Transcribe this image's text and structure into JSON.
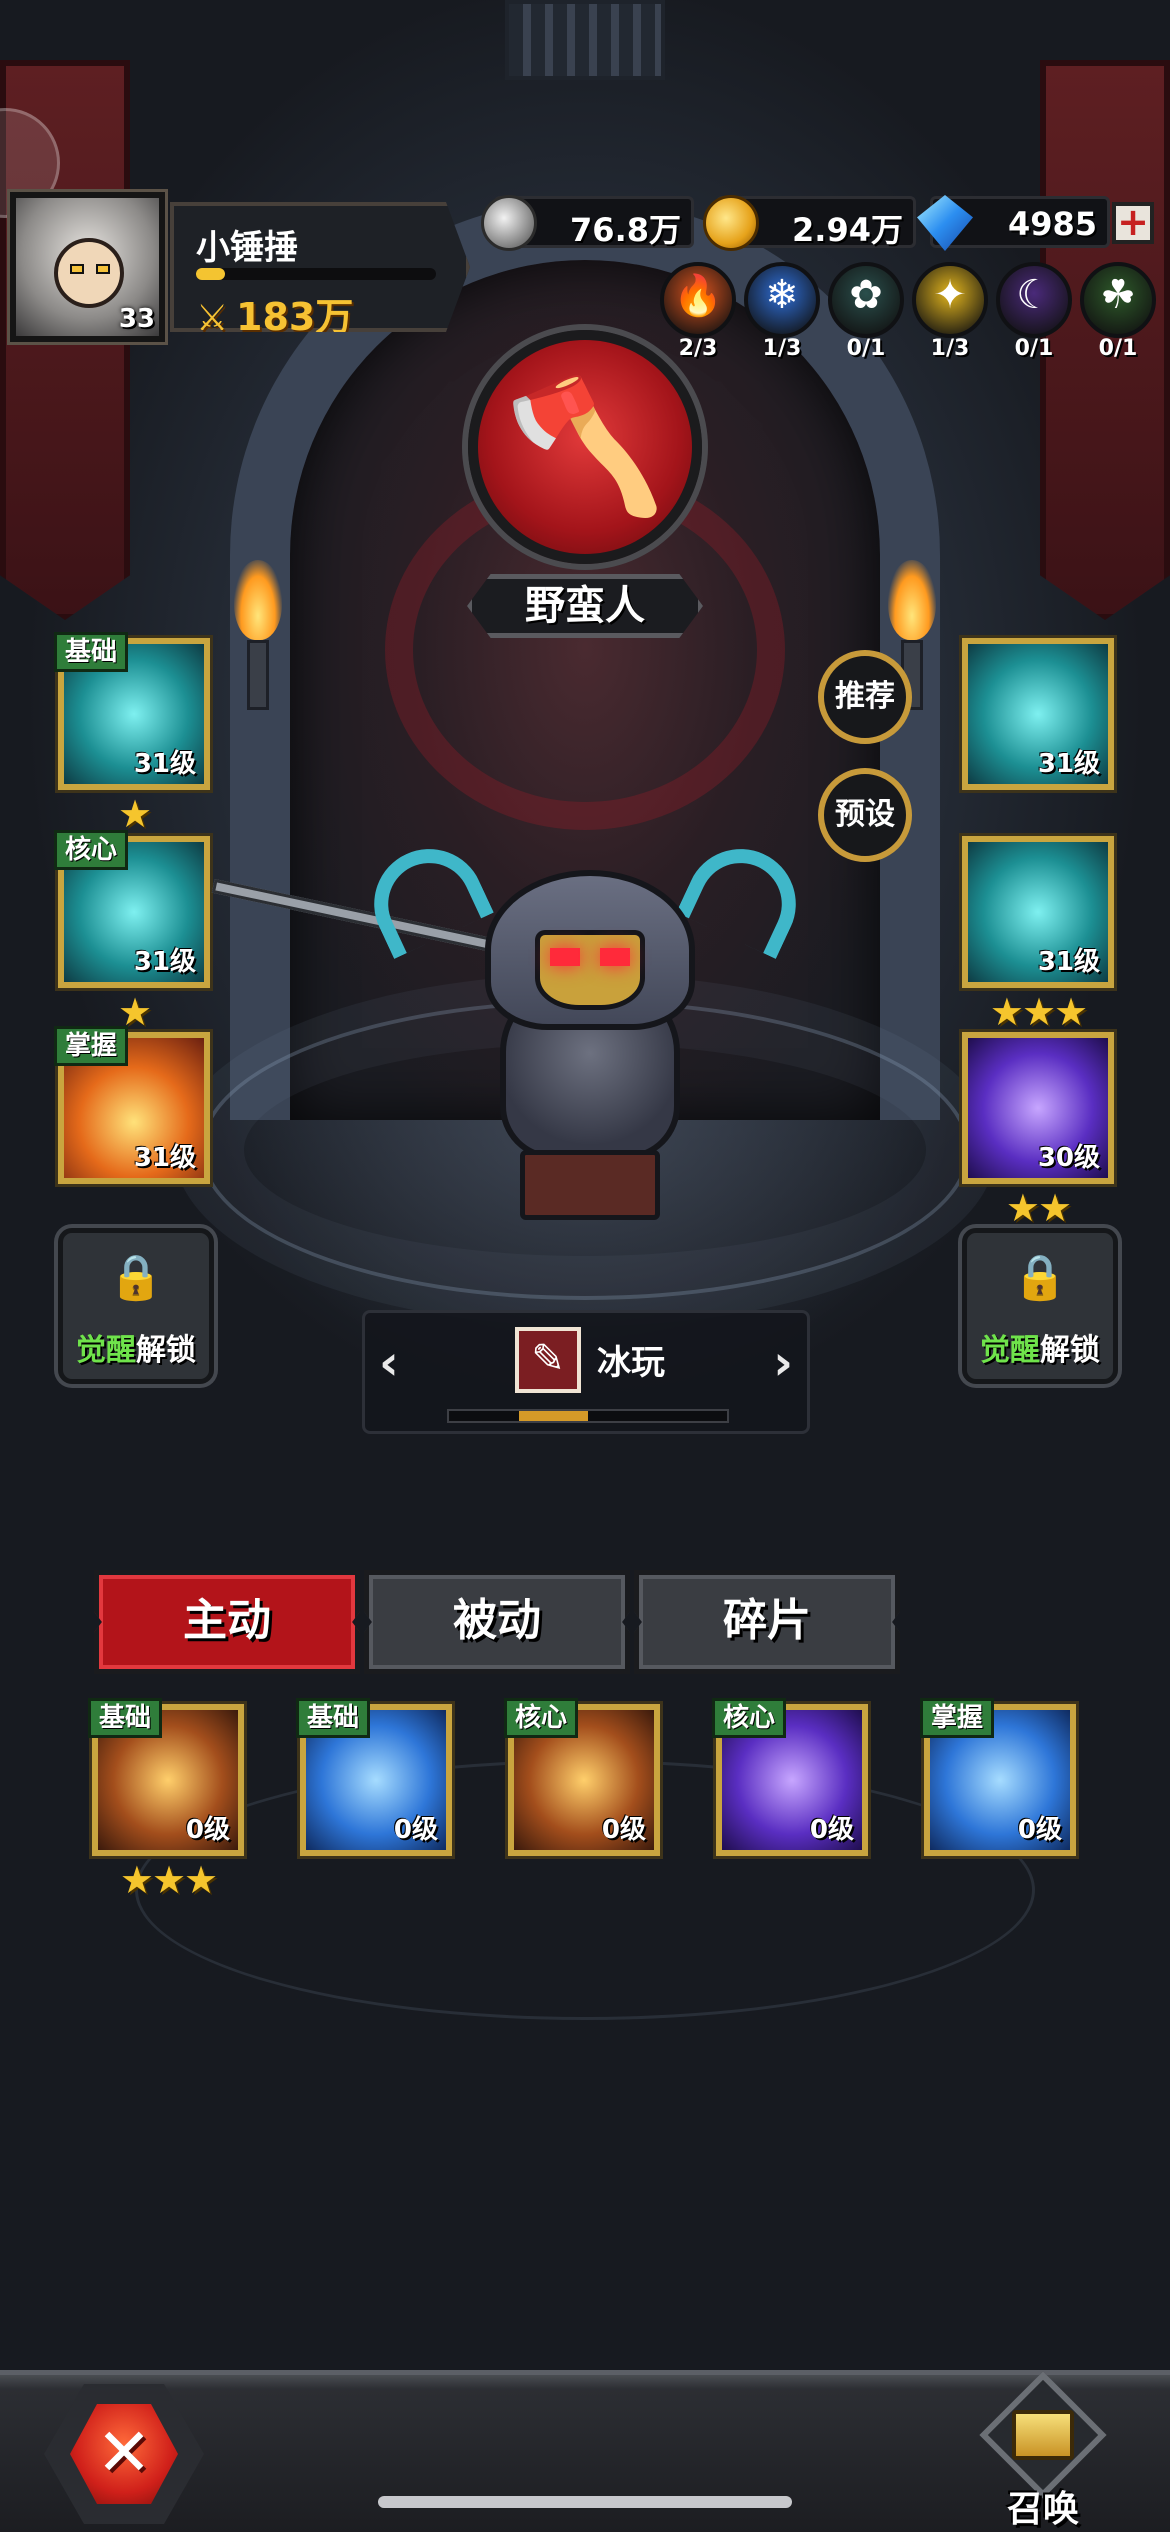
{
  "player": {
    "name": "小锤捶",
    "level": "33",
    "power": "183万",
    "exp_fraction": 0.12
  },
  "currencies": [
    {
      "icon": "silver-coin-icon",
      "value": "76.8万"
    },
    {
      "icon": "gold-coin-icon",
      "value": "2.94万"
    },
    {
      "icon": "diamond-icon",
      "value": "4985"
    }
  ],
  "elements": [
    {
      "icon": "fire-element-icon",
      "count": "2/3",
      "color": "#d9531e"
    },
    {
      "icon": "ice-element-icon",
      "count": "1/3",
      "color": "#2f6fd8"
    },
    {
      "icon": "nature-element-icon",
      "count": "0/1",
      "color": "#2a4f4c"
    },
    {
      "icon": "light-element-icon",
      "count": "1/3",
      "color": "#e2b51e"
    },
    {
      "icon": "dark-element-icon",
      "count": "0/1",
      "color": "#4a2a7a"
    },
    {
      "icon": "poison-element-icon",
      "count": "0/1",
      "color": "#2e5a2a"
    }
  ],
  "hero_class": {
    "name": "野蛮人",
    "icon": "axe-icon",
    "color": "#c4161c"
  },
  "side_buttons": {
    "recommend": "推荐",
    "preset": "预设"
  },
  "left_skills": [
    {
      "tag": "基础",
      "level": "31级",
      "stars": 1,
      "art": "ice"
    },
    {
      "tag": "核心",
      "level": "31级",
      "stars": 1,
      "art": "ice"
    },
    {
      "tag": "掌握",
      "level": "31级",
      "stars": 0,
      "art": "fire"
    }
  ],
  "right_skills": [
    {
      "level": "31级",
      "stars": 0,
      "art": "ice"
    },
    {
      "level": "31级",
      "stars": 3,
      "art": "ice"
    },
    {
      "level": "30级",
      "stars": 2,
      "art": "purple"
    }
  ],
  "awaken": {
    "green": "觉醒",
    "white": "解锁"
  },
  "skin": {
    "name": "冰玩",
    "icon": "skin-brush-icon",
    "page_index": 2,
    "page_count": 4
  },
  "tabs": [
    "主动",
    "被动",
    "碎片"
  ],
  "active_tab": 0,
  "bottom_skills": [
    {
      "tag": "基础",
      "level": "0级",
      "stars": 3,
      "art": "brown"
    },
    {
      "tag": "基础",
      "level": "0级",
      "stars": 0,
      "art": "blue"
    },
    {
      "tag": "核心",
      "level": "0级",
      "stars": 0,
      "art": "brown"
    },
    {
      "tag": "核心",
      "level": "0级",
      "stars": 0,
      "art": "purple"
    },
    {
      "tag": "掌握",
      "level": "0级",
      "stars": 0,
      "art": "blue"
    }
  ],
  "summon_label": "召唤",
  "colors": {
    "gold": "#c9a53f",
    "tab_active": "#b3141a",
    "awaken_green": "#6fe34b"
  }
}
